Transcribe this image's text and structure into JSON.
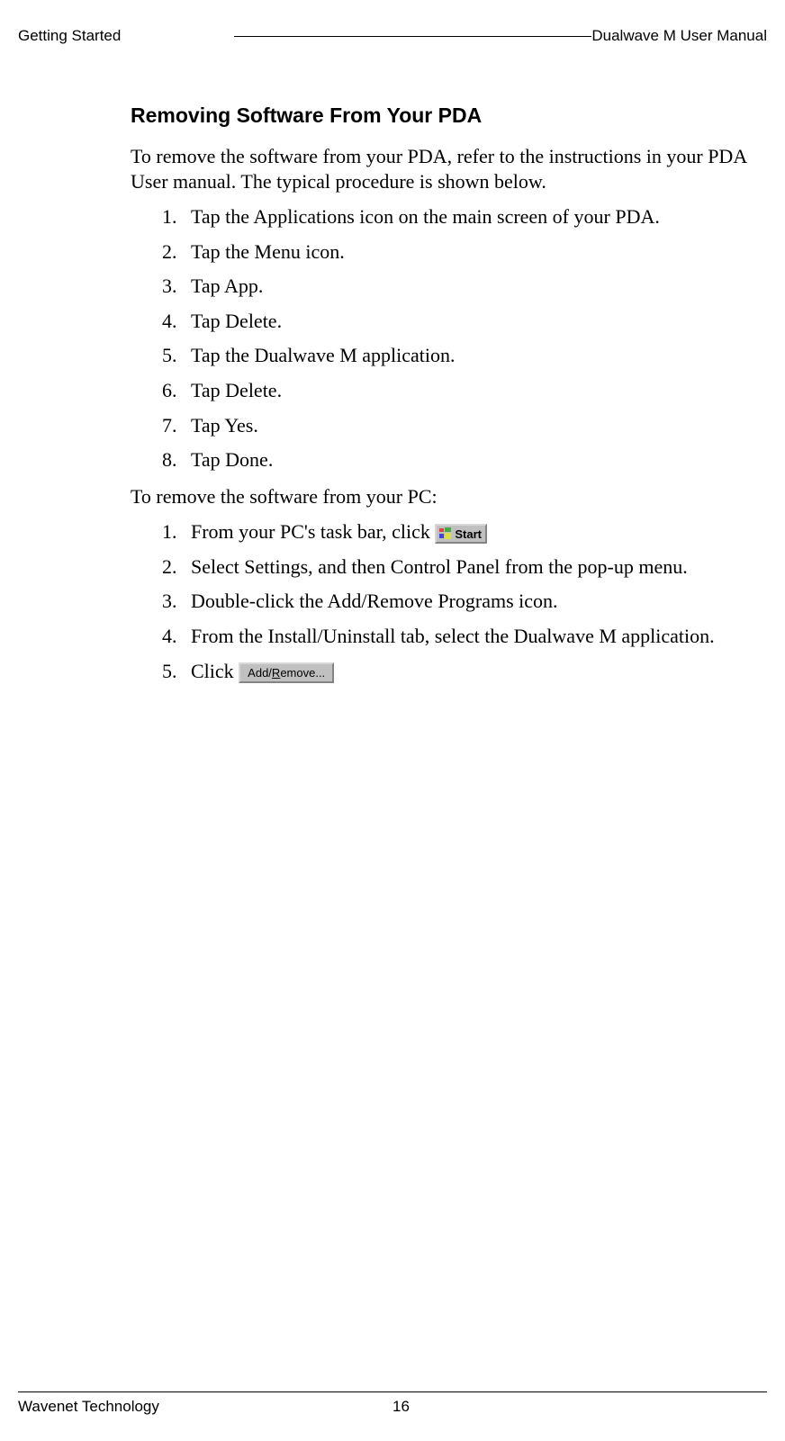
{
  "header": {
    "left": "Getting Started",
    "right": "Dualwave M User Manual"
  },
  "section": {
    "title": "Removing Software From Your PDA",
    "intro": "To remove the software from your PDA, refer to the instructions in your PDA User manual. The typical procedure is shown below.",
    "pda_steps": [
      "Tap the Applications icon on the main screen of your PDA.",
      "Tap the Menu icon.",
      "Tap App.",
      "Tap Delete.",
      "Tap the Dualwave M application.",
      "Tap Delete.",
      "Tap Yes.",
      "Tap Done."
    ],
    "pc_intro": "To remove the software from your PC:",
    "pc_steps": {
      "s1_prefix": "From your PC's task bar, click ",
      "start_label": "Start",
      "s2": "Select Settings, and then Control Panel from the pop-up menu.",
      "s3": "Double-click the Add/Remove Programs icon.",
      "s4": "From the Install/Uninstall tab, select the Dualwave M application.",
      "s5_prefix": "Click ",
      "addremove_prefix": "Add/",
      "addremove_u": "R",
      "addremove_suffix": "emove..."
    }
  },
  "footer": {
    "left": "Wavenet Technology",
    "page": "16"
  }
}
